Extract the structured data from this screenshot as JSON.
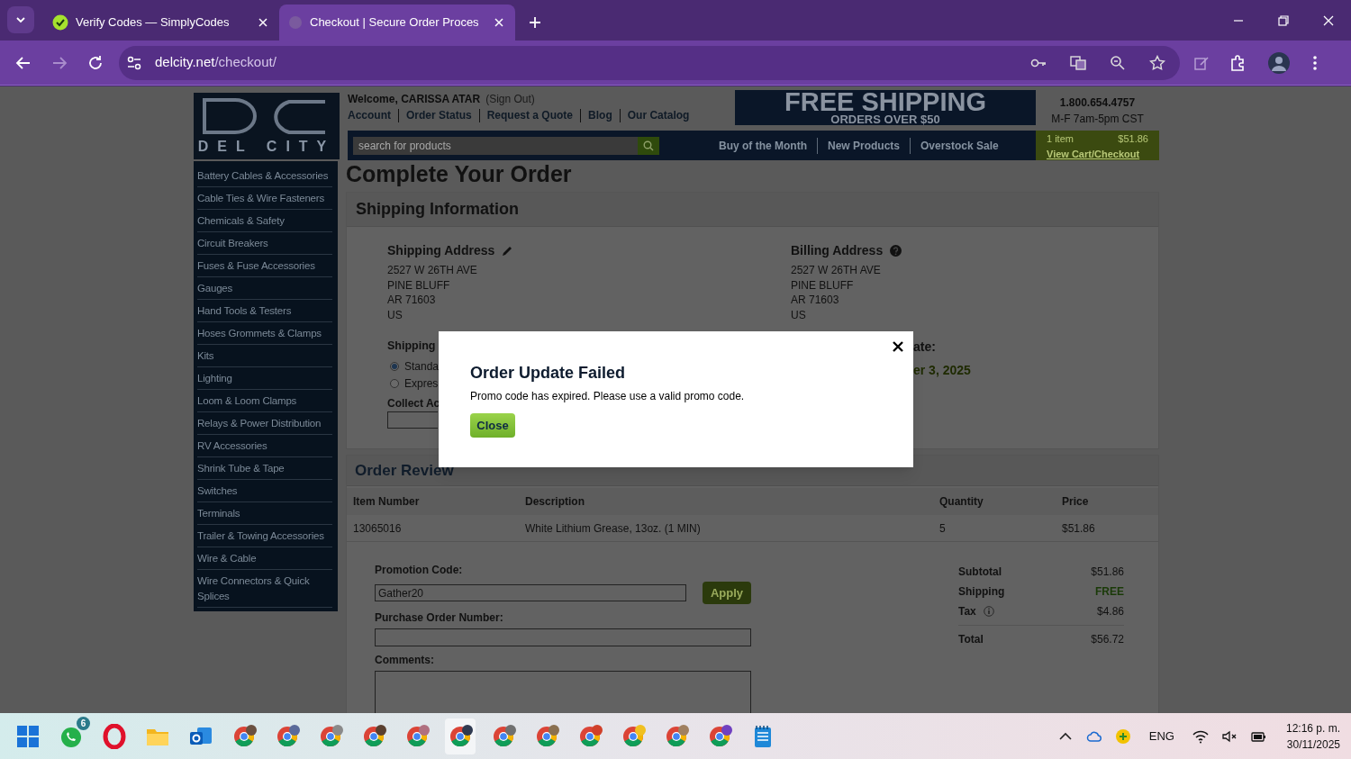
{
  "browser": {
    "tabs": [
      {
        "title": "Verify Codes — SimplyCodes",
        "kind": "simplycodes",
        "selected": false
      },
      {
        "title": "Checkout | Secure Order Proces",
        "kind": "loading",
        "selected": true
      }
    ],
    "url": {
      "domain": "delcity.net",
      "path": "/checkout/"
    }
  },
  "site": {
    "logo_text": "DEL CITY",
    "welcome": "Welcome, CARISSA ATAR",
    "sign_out": "(Sign Out)",
    "nav_links": [
      "Account",
      "Order Status",
      "Request a Quote",
      "Blog",
      "Our Catalog"
    ],
    "banner": {
      "title": "FREE SHIPPING",
      "subtitle": "ORDERS OVER $50"
    },
    "phone": "1.800.654.4757",
    "hours": "M-F 7am-5pm CST",
    "search": {
      "placeholder": "search for products"
    },
    "promo_links": [
      "Buy of the Month",
      "New Products",
      "Overstock Sale"
    ],
    "cart": {
      "count": "1 item",
      "total": "$51.86",
      "link": "View Cart/Checkout"
    }
  },
  "sidebar": {
    "categories": [
      "Battery Cables & Accessories",
      "Cable Ties & Wire Fasteners",
      "Chemicals & Safety",
      "Circuit Breakers",
      "Fuses & Fuse Accessories",
      "Gauges",
      "Hand Tools & Testers",
      "Hoses Grommets & Clamps",
      "Kits",
      "Lighting",
      "Loom & Loom Clamps",
      "Relays & Power Distribution",
      "RV Accessories",
      "Shrink Tube & Tape",
      "Switches",
      "Terminals",
      "Trailer & Towing Accessories",
      "Wire & Cable",
      "Wire Connectors & Quick Splices"
    ]
  },
  "page": {
    "title": "Complete Your Order",
    "shipping_info": {
      "heading": "Shipping Information",
      "shipping_address": {
        "heading": "Shipping Address",
        "lines": [
          "2527 W 26TH AVE",
          "PINE BLUFF",
          "AR 71603",
          "US"
        ]
      },
      "billing_address": {
        "heading": "Billing Address",
        "lines": [
          "2527 W 26TH AVE",
          "PINE BLUFF",
          "AR 71603",
          "US"
        ]
      },
      "shipping_method": {
        "label": "Shipping",
        "options": [
          {
            "label": "Standa",
            "selected": true
          },
          {
            "label": "Expres",
            "selected": false
          }
        ]
      },
      "collect_label": "Collect Ac",
      "date_label": "ate:",
      "date_value": "er 3, 2025"
    },
    "order_review": {
      "heading": "Order Review",
      "columns": [
        "Item Number",
        "Description",
        "Quantity",
        "Price"
      ],
      "rows": [
        [
          "13065016",
          "White Lithium Grease, 13oz. (1 MIN)",
          "5",
          "$51.86"
        ]
      ],
      "promo": {
        "label": "Promotion Code:",
        "value": "Gather20",
        "button": "Apply"
      },
      "po_label": "Purchase Order Number:",
      "comments_label": "Comments:",
      "totals": [
        {
          "label": "Subtotal",
          "value": "$51.86",
          "kind": "plain"
        },
        {
          "label": "Shipping",
          "value": "FREE",
          "kind": "free"
        },
        {
          "label": "Tax",
          "value": "$4.86",
          "kind": "info"
        },
        {
          "label": "Total",
          "value": "$56.72",
          "kind": "total"
        }
      ]
    }
  },
  "modal": {
    "title": "Order Update Failed",
    "message": "Promo code has expired. Please use a valid promo code.",
    "button": "Close"
  },
  "taskbar": {
    "whatsapp_badge": "6",
    "language": "ENG",
    "time": "12:16 p. m.",
    "date": "30/11/2025"
  }
}
